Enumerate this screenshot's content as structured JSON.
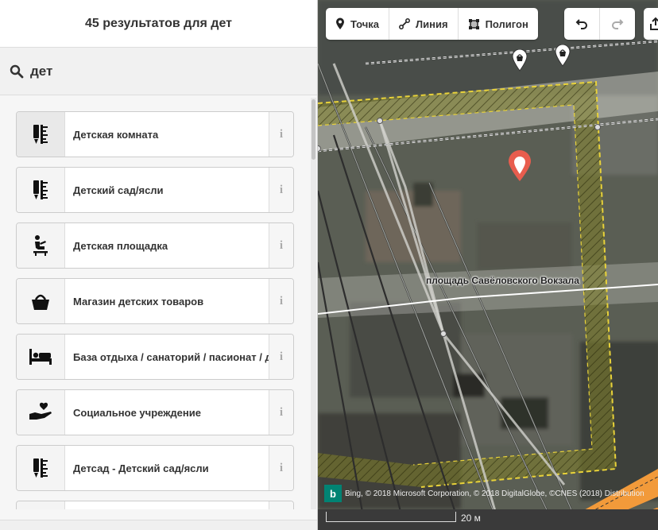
{
  "sidebar": {
    "header_title": "45 результатов для дет",
    "search": {
      "value": "дет",
      "icon": "search-icon"
    },
    "results": [
      {
        "label": "Детская комната",
        "icon": "kids-room-icon",
        "info": "i"
      },
      {
        "label": "Детский сад/ясли",
        "icon": "kindergarten-icon",
        "info": "i"
      },
      {
        "label": "Детская площадка",
        "icon": "playground-icon",
        "info": "i"
      },
      {
        "label": "Магазин детских товаров",
        "icon": "basket-icon",
        "info": "i"
      },
      {
        "label": "База отдыха / санаторий / пасионат / д",
        "icon": "bed-icon",
        "info": "i"
      },
      {
        "label": "Социальное учреждение",
        "icon": "heart-hand-icon",
        "info": "i"
      },
      {
        "label": "Детсад - Детский сад/ясли",
        "icon": "kindergarten-icon",
        "info": "i"
      }
    ]
  },
  "map": {
    "toolbar": {
      "point_label": "Точка",
      "line_label": "Линия",
      "polygon_label": "Полигон"
    },
    "street_label": "площадь Савёловского Вокзала",
    "attribution": "Bing, © 2018 Microsoft Corporation, © 2018 DigitalGlobe, ©CNES (2018) Distribution",
    "bing_logo": "b",
    "scale_label": "20 м",
    "accent_colors": {
      "selected_pin": "#e85d4e",
      "area_outline": "#e8d23a"
    }
  }
}
